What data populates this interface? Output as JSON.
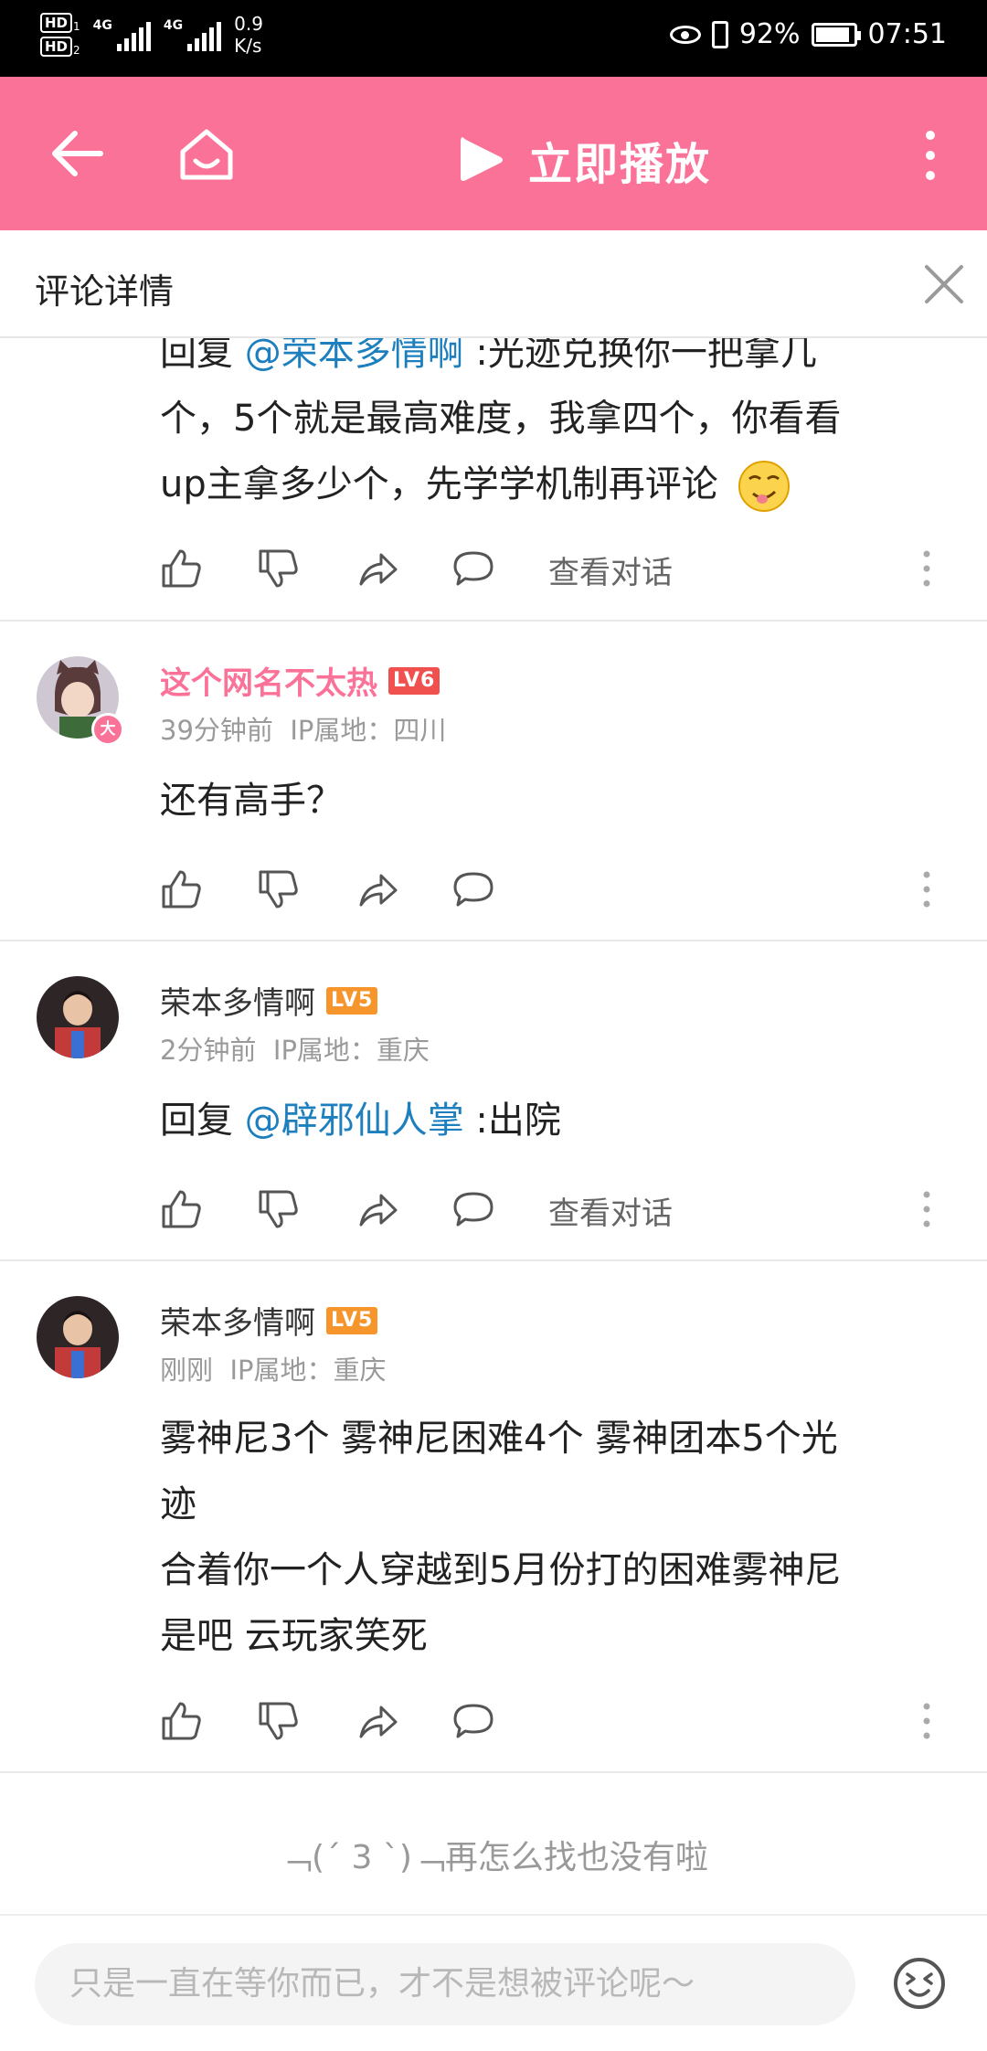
{
  "status_bar": {
    "hd1": "HD",
    "hd1_sub": "1",
    "hd2": "HD",
    "hd2_sub": "2",
    "net1": "4G",
    "net2": "4G",
    "speed_value": "0.9",
    "speed_unit": "K/s",
    "battery": "92%",
    "time": "07:51",
    "battery_level": 0.92
  },
  "toolbar": {
    "play_label": "立即播放",
    "bg_color": "#fb7299"
  },
  "panel": {
    "title": "评论详情"
  },
  "comments": [
    {
      "reply_prefix": "回复 ",
      "mention": "@荣本多情啊",
      "text_line1": " :光迹兑换你一把拿几",
      "text_line2": "个，5个就是最高难度，我拿四个，你看看",
      "text_line3": "up主拿多少个，先学学机制再评论",
      "action_text": "查看对话"
    },
    {
      "username": "这个网名不太热",
      "level": "LV6",
      "time": "39分钟前",
      "ip": "IP属地：四川",
      "avatar_badge": "大",
      "text": "还有高手？"
    },
    {
      "username": "荣本多情啊",
      "level": "LV5",
      "time": "2分钟前",
      "ip": "IP属地：重庆",
      "reply_prefix": "回复 ",
      "mention": "@辟邪仙人掌",
      "text": " :出院",
      "action_text": "查看对话"
    },
    {
      "username": "荣本多情啊",
      "level": "LV5",
      "time": "刚刚",
      "ip": "IP属地：重庆",
      "text_line1": "雾神尼3个 雾神尼困难4个  雾神团本5个光",
      "text_line2": "迹",
      "text_line3": "合着你一个人穿越到5月份打的困难雾神尼",
      "text_line4": "是吧 云玩家笑死"
    }
  ],
  "end_message": "﹁(ˊ 3 ˋ)﹁再怎么找也没有啦",
  "input": {
    "placeholder": "只是一直在等你而已，才不是想被评论呢～"
  },
  "colors": {
    "accent": "#fb7299",
    "mention": "#1d7fbd",
    "lv6": "#f0514e",
    "lv5": "#f7952d"
  }
}
